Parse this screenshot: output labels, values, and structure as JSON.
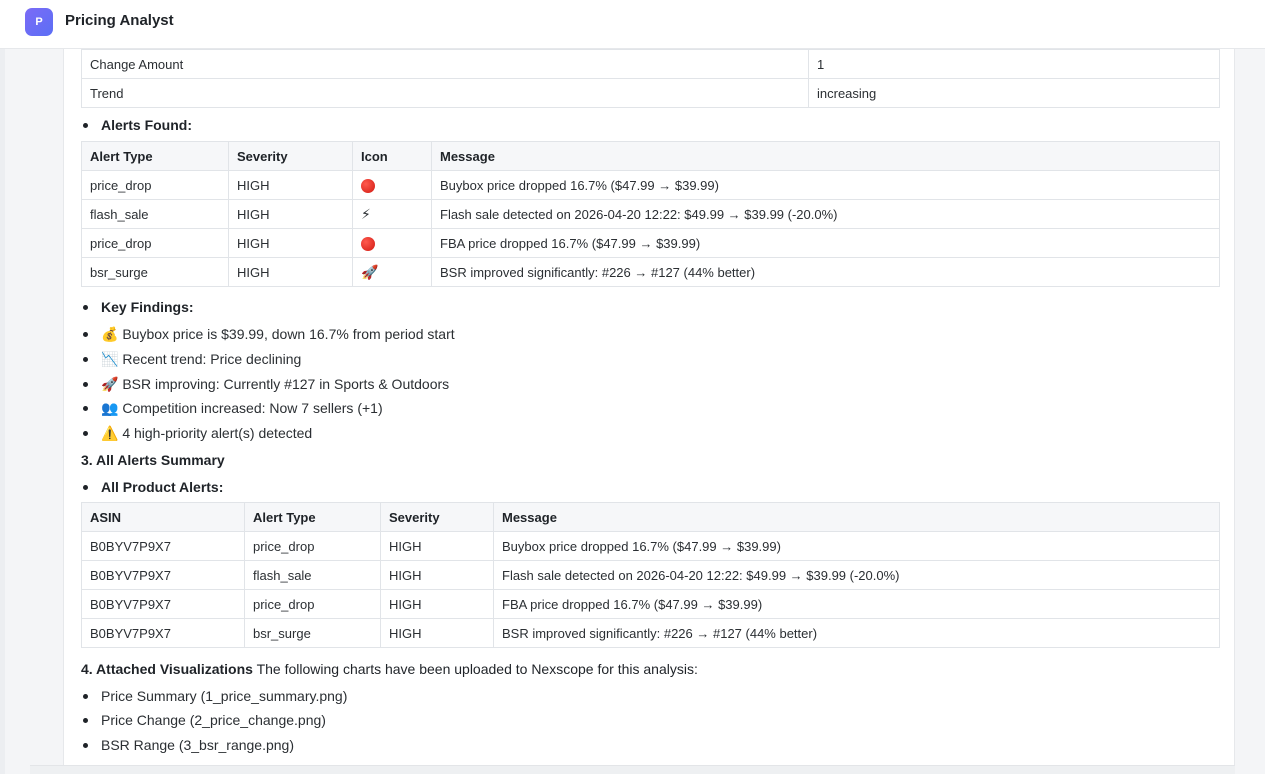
{
  "app": {
    "badge": "P",
    "title": "Pricing Analyst"
  },
  "metrics_table": {
    "rows": [
      {
        "label": "Change Amount",
        "value": "1"
      },
      {
        "label": "Trend",
        "value": "increasing"
      }
    ]
  },
  "alerts_found": {
    "heading": "Alerts Found:",
    "columns": [
      "Alert Type",
      "Severity",
      "Icon",
      "Message"
    ],
    "rows": [
      {
        "type": "price_drop",
        "severity": "HIGH",
        "icon": "red-circle-icon",
        "icon_glyph": "",
        "message": "Buybox price dropped 16.7% ($47.99 → $39.99)"
      },
      {
        "type": "flash_sale",
        "severity": "HIGH",
        "icon": "lightning-icon",
        "icon_glyph": "⚡",
        "message": "Flash sale detected on 2026-04-20 12:22: $49.99 → $39.99 (-20.0%)"
      },
      {
        "type": "price_drop",
        "severity": "HIGH",
        "icon": "red-circle-icon",
        "icon_glyph": "",
        "message": "FBA price dropped 16.7% ($47.99 → $39.99)"
      },
      {
        "type": "bsr_surge",
        "severity": "HIGH",
        "icon": "rocket-icon",
        "icon_glyph": "🚀",
        "message": "BSR improved significantly: #226 → #127 (44% better)"
      }
    ]
  },
  "key_findings": {
    "heading": "Key Findings:",
    "items": [
      {
        "icon": "money-bag-icon",
        "glyph": "💰",
        "text": "Buybox price is $39.99, down 16.7% from period start"
      },
      {
        "icon": "chart-decreasing-icon",
        "glyph": "📉",
        "text": "Recent trend: Price declining"
      },
      {
        "icon": "rocket-icon",
        "glyph": "🚀",
        "text": "BSR improving: Currently #127 in Sports & Outdoors"
      },
      {
        "icon": "people-icon",
        "glyph": "👥",
        "text": "Competition increased: Now 7 sellers (+1)"
      },
      {
        "icon": "warning-icon",
        "glyph": "⚠️",
        "text": "4 high-priority alert(s) detected"
      }
    ]
  },
  "section3": {
    "heading": "3. All Alerts Summary",
    "sub_heading": "All Product Alerts:"
  },
  "all_alerts": {
    "columns": [
      "ASIN",
      "Alert Type",
      "Severity",
      "Message"
    ],
    "rows": [
      {
        "asin": "B0BYV7P9X7",
        "type": "price_drop",
        "severity": "HIGH",
        "message": "Buybox price dropped 16.7% ($47.99 → $39.99)"
      },
      {
        "asin": "B0BYV7P9X7",
        "type": "flash_sale",
        "severity": "HIGH",
        "message": "Flash sale detected on 2026-04-20 12:22: $49.99 → $39.99 (-20.0%)"
      },
      {
        "asin": "B0BYV7P9X7",
        "type": "price_drop",
        "severity": "HIGH",
        "message": "FBA price dropped 16.7% ($47.99 → $39.99)"
      },
      {
        "asin": "B0BYV7P9X7",
        "type": "bsr_surge",
        "severity": "HIGH",
        "message": "BSR improved significantly: #226 → #127 (44% better)"
      }
    ]
  },
  "section4": {
    "heading": "4. Attached Visualizations",
    "intro": "The following charts have been uploaded to Nexscope for this analysis:",
    "items": [
      "Price Summary (1_price_summary.png)",
      "Price Change (2_price_change.png)",
      "BSR Range (3_bsr_range.png)"
    ]
  }
}
